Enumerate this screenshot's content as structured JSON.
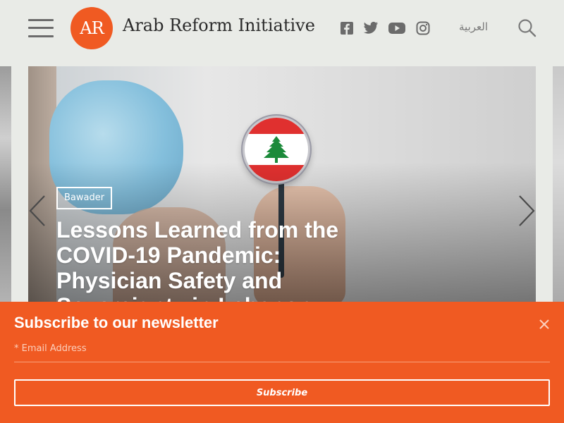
{
  "header": {
    "logo_mark": "AR",
    "site_name": "Arab Reform Initiative",
    "language_switch": "العربية",
    "social": [
      "facebook-icon",
      "twitter-icon",
      "youtube-icon",
      "instagram-icon"
    ]
  },
  "hero": {
    "category_tag": "Bawader",
    "title": "Lessons Learned from the COVID-19 Pandemic: Physician Safety and Sovereignty in Lebanon"
  },
  "newsletter": {
    "title": "Subscribe to our newsletter",
    "email_placeholder": "* Email Address",
    "subscribe_label": "Subscribe"
  },
  "colors": {
    "brand_orange": "#f05a22",
    "header_bg": "#e9ebe7",
    "text_dark": "#2b2b2b"
  }
}
